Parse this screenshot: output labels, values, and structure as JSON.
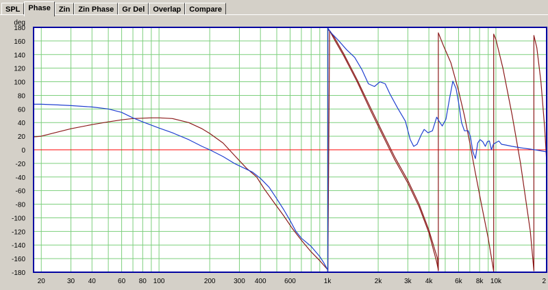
{
  "tabs": [
    {
      "label": "SPL",
      "active": false
    },
    {
      "label": "Phase",
      "active": true
    },
    {
      "label": "Zin",
      "active": false
    },
    {
      "label": "Zin Phase",
      "active": false
    },
    {
      "label": "Gr Del",
      "active": false
    },
    {
      "label": "Overlap",
      "active": false
    },
    {
      "label": "Compare",
      "active": false
    }
  ],
  "chart_data": {
    "type": "line",
    "ylabel": "deg",
    "ylim": [
      -180,
      180
    ],
    "yticks": [
      180,
      160,
      140,
      120,
      100,
      80,
      60,
      40,
      20,
      0,
      -20,
      -40,
      -60,
      -80,
      -100,
      -120,
      -140,
      -160,
      -180
    ],
    "xscale": "log",
    "xlim": [
      18,
      20000
    ],
    "xtick_labels": [
      {
        "v": 20,
        "t": "20"
      },
      {
        "v": 30,
        "t": "30"
      },
      {
        "v": 40,
        "t": "40"
      },
      {
        "v": 60,
        "t": "60"
      },
      {
        "v": 80,
        "t": "80"
      },
      {
        "v": 100,
        "t": "100"
      },
      {
        "v": 200,
        "t": "200"
      },
      {
        "v": 300,
        "t": "300"
      },
      {
        "v": 400,
        "t": "400"
      },
      {
        "v": 600,
        "t": "600"
      },
      {
        "v": 1000,
        "t": "1k"
      },
      {
        "v": 2000,
        "t": "2k"
      },
      {
        "v": 3000,
        "t": "3k"
      },
      {
        "v": 4000,
        "t": "4k"
      },
      {
        "v": 6000,
        "t": "6k"
      },
      {
        "v": 8000,
        "t": "8k"
      },
      {
        "v": 10000,
        "t": "10k"
      },
      {
        "v": 20000,
        "t": "2"
      }
    ],
    "grid": true,
    "colors": {
      "grid": "#7ccf7c",
      "zero_line": "#ff0000",
      "frame": "#0000a0",
      "blue_series": "#1f3fd0",
      "brown_series": "#8b1a1a",
      "background": "#ffffff"
    },
    "series": [
      {
        "color": "#8b1a1a",
        "points": [
          [
            18,
            19
          ],
          [
            20,
            20
          ],
          [
            25,
            26
          ],
          [
            30,
            31
          ],
          [
            40,
            37
          ],
          [
            50,
            41
          ],
          [
            60,
            44
          ],
          [
            70,
            46
          ],
          [
            80,
            46.5
          ],
          [
            90,
            47
          ],
          [
            100,
            47
          ],
          [
            120,
            46
          ],
          [
            150,
            40
          ],
          [
            180,
            31
          ],
          [
            200,
            24
          ],
          [
            240,
            10
          ],
          [
            280,
            -8
          ],
          [
            330,
            -27
          ],
          [
            380,
            -40
          ],
          [
            420,
            -57
          ],
          [
            480,
            -77
          ],
          [
            550,
            -97
          ],
          [
            620,
            -116
          ],
          [
            700,
            -133
          ],
          [
            800,
            -150
          ],
          [
            900,
            -163
          ],
          [
            1000,
            -176
          ],
          [
            1005,
            -179
          ],
          [
            1005,
            177
          ],
          [
            1040,
            174
          ],
          [
            1100,
            165
          ],
          [
            1250,
            141
          ],
          [
            1500,
            103
          ],
          [
            1800,
            62
          ],
          [
            2100,
            28
          ],
          [
            2500,
            -10
          ],
          [
            3000,
            -45
          ],
          [
            3500,
            -80
          ],
          [
            4000,
            -118
          ],
          [
            4500,
            -160
          ],
          [
            4550,
            -178
          ],
          [
            4550,
            172
          ],
          [
            4900,
            152
          ],
          [
            5400,
            128
          ],
          [
            6000,
            87
          ],
          [
            6500,
            50
          ],
          [
            7000,
            10
          ],
          [
            7500,
            -30
          ],
          [
            8200,
            -80
          ],
          [
            9000,
            -130
          ],
          [
            9500,
            -165
          ],
          [
            9700,
            -179
          ],
          [
            9700,
            170
          ],
          [
            10000,
            162
          ],
          [
            11000,
            120
          ],
          [
            12500,
            50
          ],
          [
            14000,
            -20
          ],
          [
            16000,
            -120
          ],
          [
            16800,
            -178
          ],
          [
            16800,
            168
          ],
          [
            17500,
            150
          ],
          [
            18500,
            100
          ],
          [
            19500,
            30
          ],
          [
            20000,
            -18
          ]
        ]
      },
      {
        "color": "#8b1a1a",
        "points": [
          [
            1005,
            -178
          ],
          [
            1030,
            175
          ],
          [
            1100,
            162
          ],
          [
            1250,
            138
          ],
          [
            1500,
            100
          ],
          [
            1800,
            58
          ],
          [
            2100,
            24
          ],
          [
            2500,
            -14
          ],
          [
            3000,
            -49
          ],
          [
            3500,
            -84
          ],
          [
            4000,
            -122
          ],
          [
            4450,
            -165
          ],
          [
            4550,
            -177
          ]
        ]
      },
      {
        "color": "#1f3fd0",
        "points": [
          [
            18,
            67
          ],
          [
            20,
            67
          ],
          [
            25,
            66
          ],
          [
            30,
            65
          ],
          [
            40,
            63
          ],
          [
            50,
            60
          ],
          [
            60,
            55
          ],
          [
            70,
            47
          ],
          [
            80,
            41
          ],
          [
            100,
            32
          ],
          [
            120,
            25
          ],
          [
            150,
            15
          ],
          [
            180,
            5
          ],
          [
            200,
            0
          ],
          [
            240,
            -10
          ],
          [
            280,
            -20
          ],
          [
            320,
            -27
          ],
          [
            360,
            -33
          ],
          [
            400,
            -42
          ],
          [
            450,
            -55
          ],
          [
            500,
            -72
          ],
          [
            550,
            -88
          ],
          [
            600,
            -104
          ],
          [
            650,
            -120
          ],
          [
            700,
            -130
          ],
          [
            800,
            -142
          ],
          [
            900,
            -157
          ],
          [
            950,
            -166
          ],
          [
            1000,
            -176
          ],
          [
            1005,
            -179
          ],
          [
            1005,
            179
          ],
          [
            1050,
            172
          ],
          [
            1150,
            162
          ],
          [
            1300,
            147
          ],
          [
            1450,
            136
          ],
          [
            1600,
            118
          ],
          [
            1750,
            97
          ],
          [
            1900,
            93
          ],
          [
            2050,
            100
          ],
          [
            2200,
            97
          ],
          [
            2350,
            82
          ],
          [
            2600,
            62
          ],
          [
            2900,
            42
          ],
          [
            3100,
            15
          ],
          [
            3250,
            5
          ],
          [
            3400,
            8
          ],
          [
            3600,
            22
          ],
          [
            3750,
            30
          ],
          [
            3950,
            25
          ],
          [
            4200,
            28
          ],
          [
            4450,
            48
          ],
          [
            4600,
            42
          ],
          [
            4800,
            35
          ],
          [
            5050,
            45
          ],
          [
            5300,
            75
          ],
          [
            5550,
            101
          ],
          [
            5800,
            90
          ],
          [
            6000,
            70
          ],
          [
            6250,
            40
          ],
          [
            6500,
            28
          ],
          [
            6850,
            28
          ],
          [
            7050,
            20
          ],
          [
            7300,
            -3
          ],
          [
            7550,
            -13
          ],
          [
            7800,
            10
          ],
          [
            8050,
            15
          ],
          [
            8350,
            12
          ],
          [
            8650,
            5
          ],
          [
            8900,
            12
          ],
          [
            9150,
            13
          ],
          [
            9400,
            0
          ],
          [
            9650,
            8
          ],
          [
            9900,
            10
          ],
          [
            10400,
            13
          ],
          [
            10800,
            8
          ],
          [
            11400,
            7
          ],
          [
            12500,
            5
          ],
          [
            14000,
            3
          ],
          [
            16000,
            1
          ],
          [
            18000,
            -1
          ],
          [
            20000,
            -3
          ]
        ]
      }
    ]
  }
}
